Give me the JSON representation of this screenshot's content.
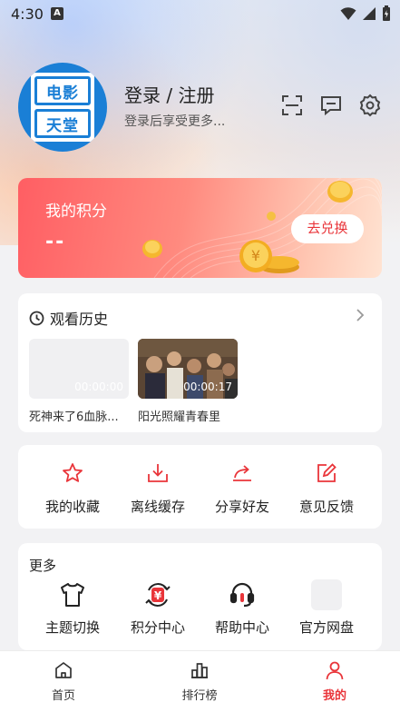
{
  "status_bar": {
    "time": "4:30",
    "notification_letter": "A"
  },
  "profile": {
    "avatar_text_top": "电影",
    "avatar_text_bottom": "天堂",
    "login_title": "登录 / 注册",
    "login_subtitle": "登录后享受更多..."
  },
  "header_icons": [
    "scan-icon",
    "message-icon",
    "settings-icon"
  ],
  "points": {
    "title": "我的积分",
    "value": "--",
    "redeem_label": "去兑换"
  },
  "history": {
    "title": "观看历史",
    "items": [
      {
        "title": "死神来了6血脉...",
        "duration": "00:00:00"
      },
      {
        "title": "阳光照耀青春里",
        "duration": "00:00:17"
      }
    ]
  },
  "tools": [
    {
      "label": "我的收藏",
      "icon": "star-icon"
    },
    {
      "label": "离线缓存",
      "icon": "download-icon"
    },
    {
      "label": "分享好友",
      "icon": "share-icon"
    },
    {
      "label": "意见反馈",
      "icon": "feedback-edit-icon"
    }
  ],
  "more": {
    "title": "更多",
    "items": [
      {
        "label": "主题切换",
        "icon": "tshirt-icon"
      },
      {
        "label": "积分中心",
        "icon": "yuan-exchange-icon"
      },
      {
        "label": "帮助中心",
        "icon": "headset-icon"
      },
      {
        "label": "官方网盘",
        "icon": "cloud-drive-icon"
      }
    ]
  },
  "nav": [
    {
      "label": "首页",
      "icon": "home-icon"
    },
    {
      "label": "排行榜",
      "icon": "ranking-icon"
    },
    {
      "label": "我的",
      "icon": "user-icon",
      "active": true
    }
  ],
  "colors": {
    "accent": "#e9353a",
    "brand_blue": "#1a7fd6"
  }
}
